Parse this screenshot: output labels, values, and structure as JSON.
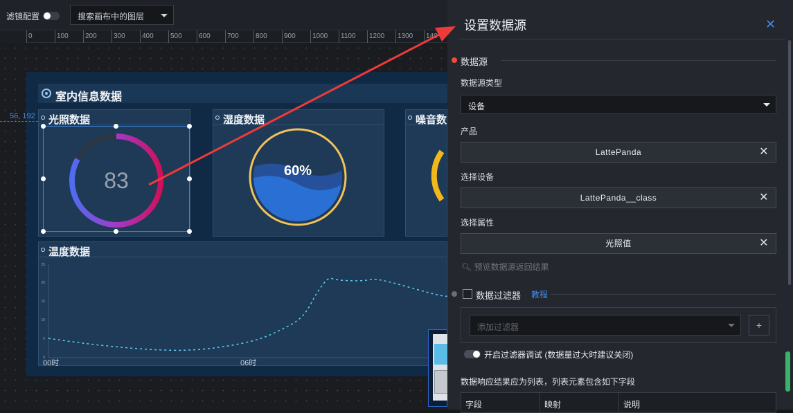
{
  "toolbar": {
    "filter_label": "滤镜配置",
    "search_value": "搜索画布中的图层"
  },
  "ruler": {
    "ticks": [
      "0",
      "100",
      "200",
      "300",
      "400",
      "500",
      "600",
      "700",
      "800",
      "900",
      "1000",
      "1100",
      "1200",
      "1300",
      "140"
    ]
  },
  "canvas": {
    "coord_readout": "56, 192",
    "screen_title": "室内信息数据",
    "cards": {
      "light": {
        "title": "光照数据",
        "value": "83",
        "gauge_fraction": 0.83
      },
      "humidity": {
        "title": "湿度数据",
        "value": "60%",
        "fill_fraction": 0.6
      },
      "noise": {
        "title": "噪音数"
      },
      "temperature": {
        "title": "温度数据",
        "y_ticks": [
          "25",
          "20",
          "15",
          "10",
          "5",
          "0"
        ],
        "x_labels": [
          "00时",
          "06时"
        ]
      }
    }
  },
  "panel": {
    "title": "设置数据源",
    "section_datasource": "数据源",
    "type_label": "数据源类型",
    "type_value": "设备",
    "product_label": "产品",
    "product_value": "LattePanda",
    "device_label": "选择设备",
    "device_value": "LattePanda__class",
    "property_label": "选择属性",
    "property_value": "光照值",
    "preview_link": "预览数据源返回结果",
    "filter_title": "数据过滤器",
    "tutorial_link": "教程",
    "filter_placeholder": "添加过滤器",
    "plus": "+",
    "debug_text": "开启过滤器调试  (数据量过大时建议关闭)",
    "result_note": "数据响应结果应为列表，列表元素包含如下字段",
    "table_headers": [
      "字段",
      "映射",
      "说明"
    ]
  },
  "colors": {
    "accent_blue": "#3f8ff0",
    "arrow_red": "#f03a3a",
    "section_dot_red": "#f04a3a",
    "wave_blue": "#2a6fd4",
    "ring_gold": "#f3c25a",
    "line_cyan": "#5fd0f2"
  }
}
